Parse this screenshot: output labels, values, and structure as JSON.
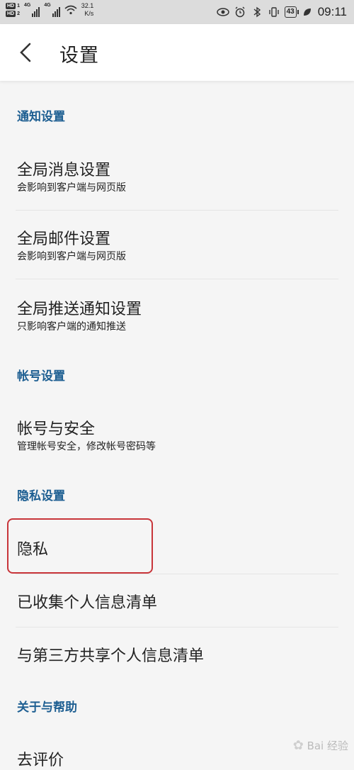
{
  "status_bar": {
    "hd1": "HD",
    "hd1_num": "1",
    "hd2": "HD",
    "hd2_num": "2",
    "net1": "4G",
    "net2": "4G",
    "speed_value": "32.1",
    "speed_unit": "K/s",
    "battery": "43",
    "time": "09:11"
  },
  "header": {
    "title": "设置"
  },
  "sections": {
    "notify": "通知设置",
    "account": "帐号设置",
    "privacy": "隐私设置",
    "about": "关于与帮助"
  },
  "items": {
    "global_msg": {
      "title": "全局消息设置",
      "subtitle": "会影响到客户端与网页版"
    },
    "global_mail": {
      "title": "全局邮件设置",
      "subtitle": "会影响到客户端与网页版"
    },
    "global_push": {
      "title": "全局推送通知设置",
      "subtitle": "只影响客户端的通知推送"
    },
    "account_security": {
      "title": "帐号与安全",
      "subtitle": "管理帐号安全，修改帐号密码等"
    },
    "privacy": {
      "title": "隐私"
    },
    "collected_info": {
      "title": "已收集个人信息清单"
    },
    "third_party": {
      "title": "与第三方共享个人信息清单"
    },
    "rate": {
      "title": "去评价"
    }
  },
  "watermark": {
    "text": "Bai 经验"
  },
  "colors": {
    "section_text": "#1e5f92",
    "highlight": "#c8353a",
    "status_bar_bg": "#dcdcdc"
  }
}
